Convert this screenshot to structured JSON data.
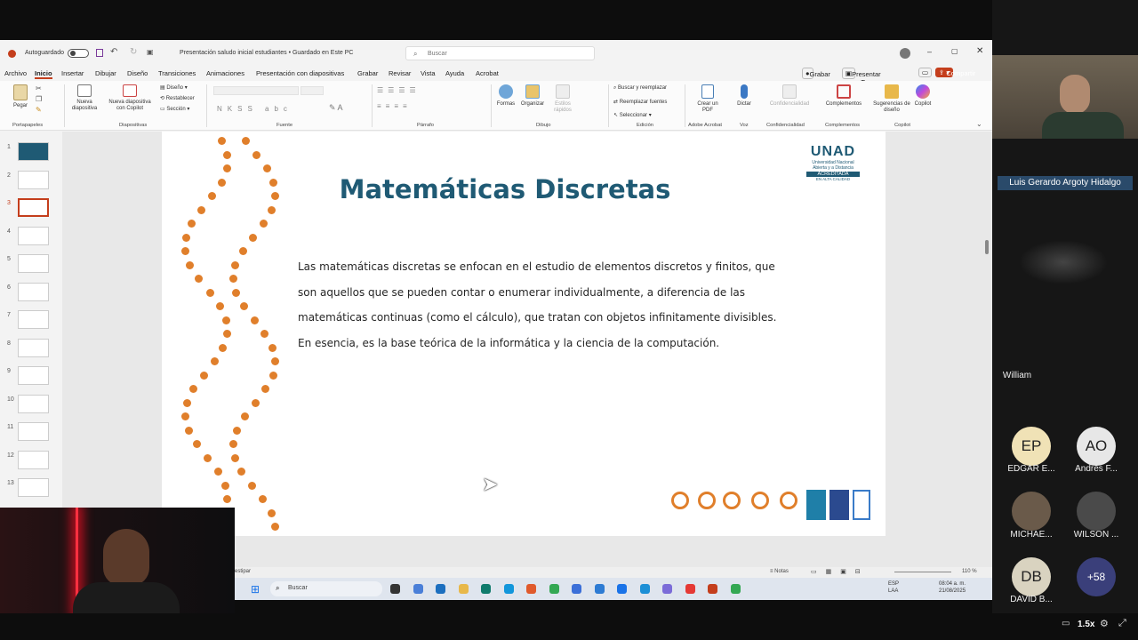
{
  "window": {
    "autosave_label": "Autoguardado",
    "title": "Presentación saludo inicial estudiantes • Guardado en Este PC",
    "search_placeholder": "Buscar"
  },
  "menu": [
    "Archivo",
    "Inicio",
    "Insertar",
    "Dibujar",
    "Diseño",
    "Transiciones",
    "Animaciones",
    "Presentación con diapositivas",
    "Grabar",
    "Revisar",
    "Vista",
    "Ayuda",
    "Acrobat"
  ],
  "menu_right": {
    "record": "Grabar",
    "present_teams": "Presentar en Teams",
    "share": "Compartir"
  },
  "ribbon": {
    "paste": "Pegar",
    "new_slide": "Nueva diapositiva",
    "new_slide_copilot": "Nueva diapositiva con Copilot",
    "layout": "Diseño",
    "reset": "Restablecer",
    "section": "Sección",
    "shapes": "Formas",
    "arrange": "Organizar",
    "quick_styles": "Estilos rápidos",
    "find_replace": "Buscar y reemplazar",
    "replace_fonts": "Reemplazar fuentes",
    "select": "Seleccionar",
    "create_pdf": "Crear un PDF",
    "dictate": "Dictar",
    "confidentiality": "Confidencialidad",
    "addins": "Complementos",
    "design_ideas": "Sugerencias de diseño",
    "copilot": "Copilot",
    "groups": {
      "clipboard": "Portapapeles",
      "slides": "Diapositivas",
      "font": "Fuente",
      "paragraph": "Párrafo",
      "drawing": "Dibujo",
      "editing": "Edición",
      "acrobat": "Adobe Acrobat",
      "voice": "Voz",
      "confidentiality": "Confidencialidad",
      "addins": "Complementos",
      "copilot": "Copilot"
    }
  },
  "thumbnails": [
    "1",
    "2",
    "3",
    "4",
    "5",
    "6",
    "7",
    "8",
    "9",
    "10",
    "11",
    "12",
    "13"
  ],
  "selected_slide": 3,
  "slide": {
    "title": "Matemáticas Discretas",
    "paragraph_lines": [
      "Las matemáticas discretas se enfocan en el estudio de elementos discretos y finitos, que",
      "son aquellos que se pueden contar o enumerar individualmente, a diferencia de las",
      "matemáticas continuas (como el cálculo), que tratan con objetos infinitamente divisibles.",
      "En esencia, es la base teórica de la informática y la ciencia de la computación."
    ],
    "logo": {
      "brand": "UNAD",
      "line1": "Universidad Nacional",
      "line2": "Abierta y a Distancia",
      "line3": "ACREDITADA",
      "line4": "EN ALTA CALIDAD"
    },
    "accent_color": "#e07f2b",
    "title_color": "#1f5a74"
  },
  "status": {
    "notes": "Notas",
    "zoom": "110 %",
    "prev_text": "estipar"
  },
  "taskbar": {
    "search": "Buscar",
    "lang": "ESP",
    "lang2": "LAA",
    "time": "08:04 a. m.",
    "date": "21/08/2025"
  },
  "participants": {
    "presenter": "Luis Gerardo Argoty Hidalgo",
    "william": "William",
    "list": [
      {
        "initials": "EP",
        "name": "EDGAR E...",
        "color": "#f0e2b6"
      },
      {
        "initials": "AO",
        "name": "Andrés F...",
        "color": "#e7e7e7"
      },
      {
        "initials": "",
        "name": "MICHAE...",
        "color": "#555"
      },
      {
        "initials": "",
        "name": "WILSON ...",
        "color": "#444"
      },
      {
        "initials": "DB",
        "name": "DAVID B...",
        "color": "#d9d3c0"
      }
    ],
    "more": "+58"
  },
  "player": {
    "speed": "1.5x"
  }
}
